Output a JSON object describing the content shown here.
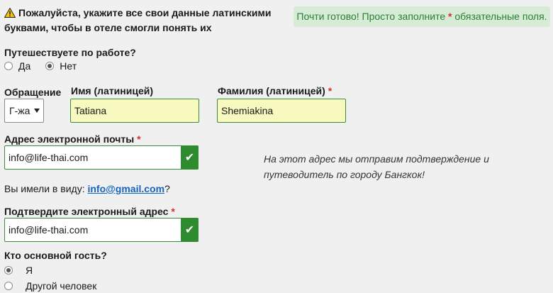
{
  "warning": {
    "text": "Пожалуйста, укажите все свои данные латинскими буквами, чтобы в отеле смогли понять их"
  },
  "notice": {
    "prefix": "Почти готово! Просто заполните",
    "asterisk": "*",
    "suffix": "обязательные поля."
  },
  "business_trip": {
    "label": "Путешествуете по работе?",
    "options": [
      "Да",
      "Нет"
    ],
    "selected": "Нет"
  },
  "title_field": {
    "label": "Обращение",
    "value": "Г-жа"
  },
  "first_name": {
    "label": "Имя (латиницей)",
    "value": "Tatiana"
  },
  "last_name": {
    "label": "Фамилия (латиницей)",
    "required_mark": "*",
    "value": "Shemiakina"
  },
  "email": {
    "label": "Адрес электронной почты",
    "required_mark": "*",
    "value": "info@life-thai.com",
    "hint": "На этот адрес мы отправим подтверждение и путеводитель по городу Бангкок!"
  },
  "suggestion": {
    "prefix": "Вы имели в виду:",
    "link": "info@gmail.com",
    "suffix": "?"
  },
  "confirm_email": {
    "label": "Подтвердите электронный адрес",
    "required_mark": "*",
    "value": "info@life-thai.com"
  },
  "main_guest": {
    "label": "Кто основной гость?",
    "options": [
      "Я",
      "Другой человек"
    ],
    "selected": "Я"
  },
  "colors": {
    "valid_green": "#2e8b2e",
    "notice_bg": "#d6ecd6",
    "required_red": "#d32f2f",
    "input_yellow": "#f7f9be",
    "link_blue": "#1565c0"
  }
}
